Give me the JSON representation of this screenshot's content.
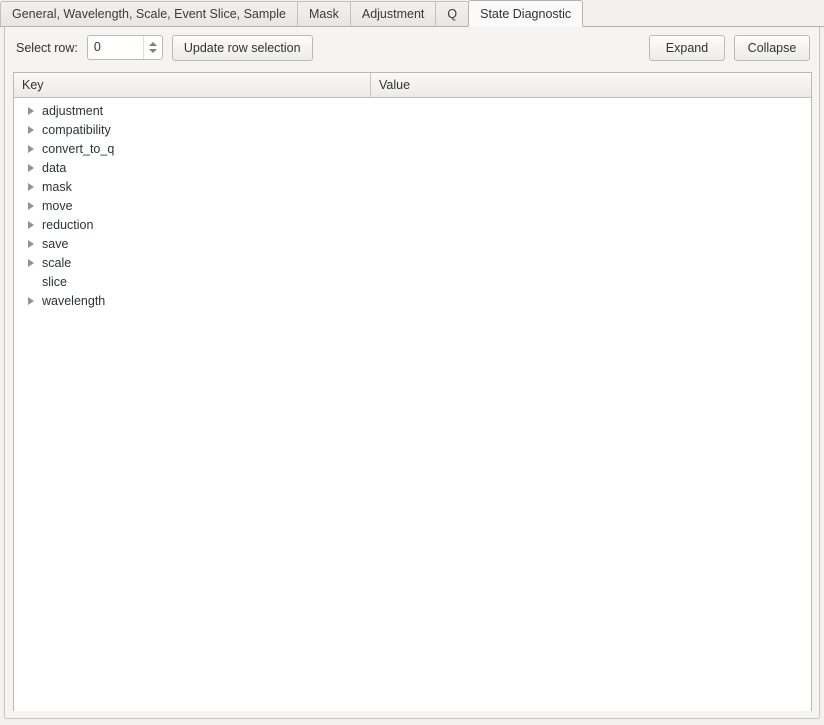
{
  "tabs": [
    {
      "label": "General, Wavelength, Scale, Event Slice, Sample",
      "active": false
    },
    {
      "label": "Mask",
      "active": false
    },
    {
      "label": "Adjustment",
      "active": false
    },
    {
      "label": "Q",
      "active": false
    },
    {
      "label": "State Diagnostic",
      "active": true
    }
  ],
  "toolbar": {
    "select_row_label": "Select row:",
    "row_value": "0",
    "update_button": "Update row selection",
    "expand_button": "Expand",
    "collapse_button": "Collapse"
  },
  "tree": {
    "columns": [
      "Key",
      "Value"
    ],
    "rows": [
      {
        "key": "adjustment",
        "value": "",
        "expandable": true
      },
      {
        "key": "compatibility",
        "value": "",
        "expandable": true
      },
      {
        "key": "convert_to_q",
        "value": "",
        "expandable": true
      },
      {
        "key": "data",
        "value": "",
        "expandable": true
      },
      {
        "key": "mask",
        "value": "",
        "expandable": true
      },
      {
        "key": "move",
        "value": "",
        "expandable": true
      },
      {
        "key": "reduction",
        "value": "",
        "expandable": true
      },
      {
        "key": "save",
        "value": "",
        "expandable": true
      },
      {
        "key": "scale",
        "value": "",
        "expandable": true
      },
      {
        "key": "slice",
        "value": "",
        "expandable": false
      },
      {
        "key": "wavelength",
        "value": "",
        "expandable": true
      }
    ]
  },
  "colors": {
    "window_bg": "#f2f1f0",
    "panel_bg": "#f5f4f2",
    "list_bg": "#ffffff",
    "border": "#bdb9b4",
    "text": "#2e3436",
    "twisty": "#8f9498"
  }
}
